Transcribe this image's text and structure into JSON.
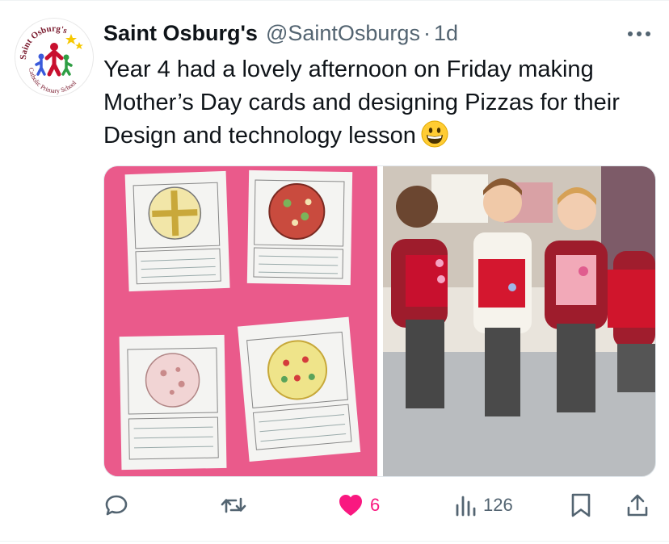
{
  "tweet": {
    "author_name": "Saint Osburg's",
    "handle": "@SaintOsburgs",
    "separator": "·",
    "time": "1d",
    "text": "Year 4 had a lovely afternoon on Friday making Mother’s Day cards and designing Pizzas for their Design and technology lesson",
    "emoji": "grinning-face-emoji",
    "avatar_logo": {
      "top_text": "Saint Osburg's",
      "bottom_text": "Catholic Primary School"
    }
  },
  "media": {
    "left_photo": "pizza-design-worksheets-photo",
    "right_photo": "pupils-holding-mothers-day-cards-photo"
  },
  "actions": {
    "reply": {
      "icon": "reply-icon",
      "count": ""
    },
    "repost": {
      "icon": "repost-icon",
      "count": ""
    },
    "like": {
      "icon": "heart-icon",
      "count": "6",
      "color": "#f91880"
    },
    "views": {
      "icon": "views-icon",
      "count": "126"
    },
    "bookmark": {
      "icon": "bookmark-icon",
      "count": ""
    },
    "share": {
      "icon": "share-icon",
      "count": ""
    }
  },
  "colors": {
    "text": "#0f1419",
    "secondary": "#536471",
    "like": "#f91880",
    "photo_background": "#ea5a8b"
  }
}
